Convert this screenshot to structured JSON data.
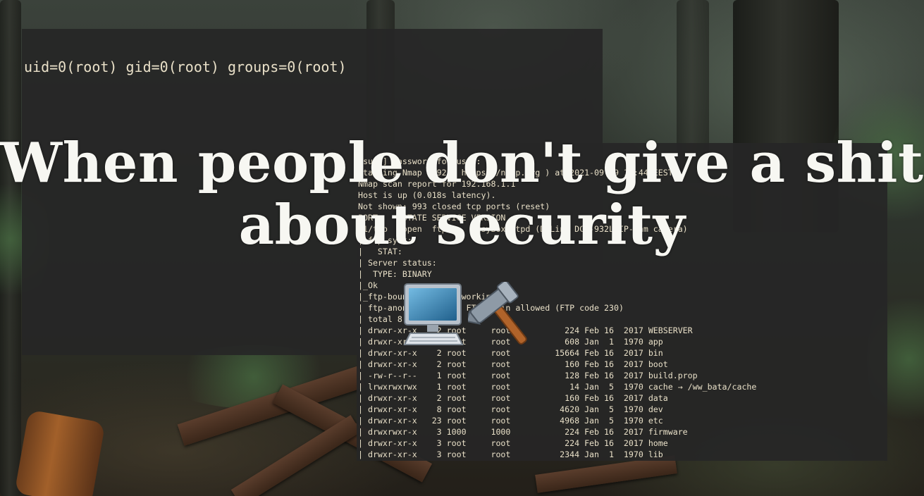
{
  "terminal_top": {
    "line": "uid=0(root) gid=0(root) groups=0(root)"
  },
  "terminal_nmap": {
    "lines": [
      "[sudo] password for user:",
      "Starting Nmap 7.92 ( https://nmap.org ) at 2021-09-29 14:44 EEST",
      "Nmap scan report for 192.168.1.1",
      "Host is up (0.018s latency).",
      "Not shown: 993 closed tcp ports (reset)",
      "PORT     STATE SERVICE VERSION",
      "21/tcp   open  ftp     BusyBox ftpd (D-Link DCS-932L IP-Cam camera)",
      "| ftp-syst:",
      "|   STAT:",
      "| Server status:",
      "|  TYPE: BINARY",
      "|_Ok",
      "|_ftp-bounce: bounce working!",
      "| ftp-anon: Anonymous FTP login allowed (FTP code 230)",
      "| total 8",
      "| drwxr-xr-x    2 root     root           224 Feb 16  2017 WEBSERVER",
      "| drwxr-xr-x    2 root     root           608 Jan  1  1970 app",
      "| drwxr-xr-x    2 root     root         15664 Feb 16  2017 bin",
      "| drwxr-xr-x    2 root     root           160 Feb 16  2017 boot",
      "| -rw-r--r--    1 root     root           128 Feb 16  2017 build.prop",
      "| lrwxrwxrwx    1 root     root            14 Jan  5  1970 cache → /ww_bata/cache",
      "| drwxr-xr-x    2 root     root           160 Feb 16  2017 data",
      "| drwxr-xr-x    8 root     root          4620 Jan  5  1970 dev",
      "| drwxr-xr-x   23 root     root          4968 Jan  5  1970 etc",
      "| drwxrwxr-x    3 1000     1000           224 Feb 16  2017 firmware",
      "| drwxr-xr-x    3 root     root           224 Feb 16  2017 home",
      "| drwxr-xr-x    3 root     root          2344 Jan  1  1970 lib"
    ]
  },
  "caption": {
    "line1": "When people don't give a shit",
    "line2": "about security"
  },
  "emojis": {
    "computer": "desktop-computer-icon",
    "hammer": "hammer-icon"
  },
  "colors": {
    "terminal_bg": "#262626",
    "terminal_text": "#e9e0c8",
    "caption_text": "#f7f7f2"
  }
}
